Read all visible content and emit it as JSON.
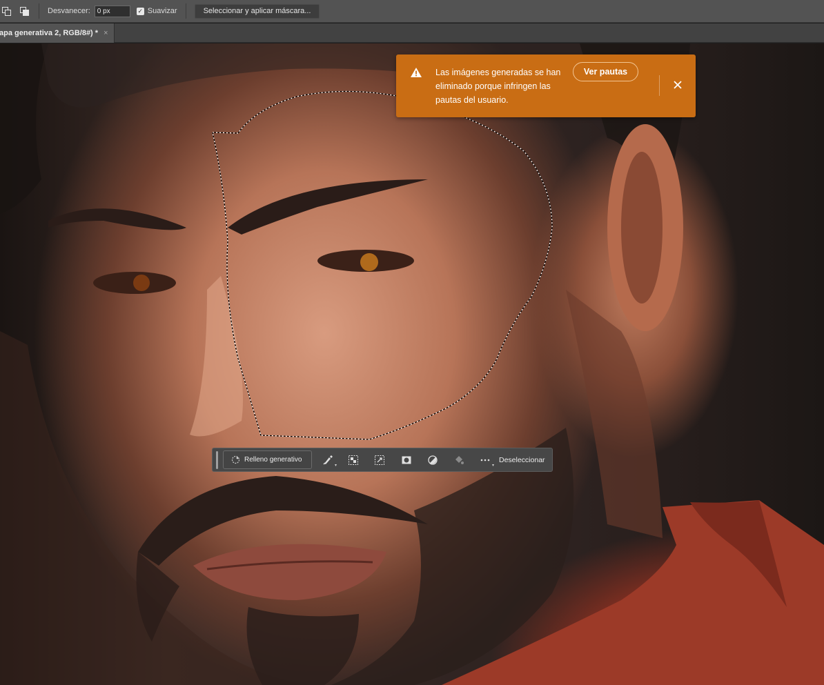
{
  "options_bar": {
    "feather_label": "Desvanecer:",
    "feather_value": "0 px",
    "smooth_label": "Suavizar",
    "smooth_checked": true,
    "select_mask_button": "Seleccionar y aplicar máscara..."
  },
  "document_tab": {
    "title": "apa generativa 2, RGB/8#) *",
    "close_symbol": "×"
  },
  "alert": {
    "message": "Las imágenes generadas se han eliminado porque infringen las pautas del usuario.",
    "button_label": "Ver pautas",
    "icon": "warning-icon",
    "background_color": "#c96d14"
  },
  "contextual_taskbar": {
    "generative_fill_label": "Relleno generativo",
    "deselect_label": "Deseleccionar",
    "tools": [
      "brush-icon",
      "invert-selection-icon",
      "transform-selection-icon",
      "mask-icon",
      "adjustment-icon",
      "fill-icon",
      "more-icon"
    ]
  }
}
